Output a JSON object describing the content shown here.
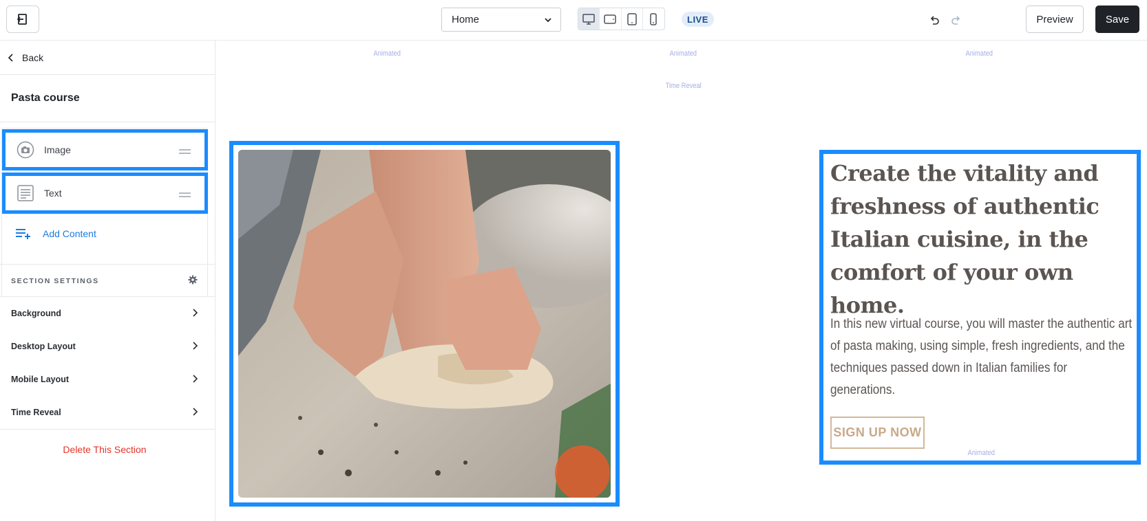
{
  "topbar": {
    "page_select": {
      "value": "Home"
    },
    "live_badge": "LIVE",
    "preview_label": "Preview",
    "save_label": "Save"
  },
  "sidebar": {
    "back_label": "Back",
    "section_title": "Pasta course",
    "content_items": [
      {
        "label": "Image",
        "icon": "camera-icon"
      },
      {
        "label": "Text",
        "icon": "text-block-icon"
      }
    ],
    "add_content_label": "Add Content",
    "section_settings_heading": "SECTION SETTINGS",
    "settings": [
      {
        "label": "Background"
      },
      {
        "label": "Desktop Layout"
      },
      {
        "label": "Mobile Layout"
      },
      {
        "label": "Time Reveal"
      }
    ],
    "delete_label": "Delete This Section"
  },
  "canvas": {
    "animated_label": "Animated",
    "time_reveal_label": "Time Reveal",
    "headline": "Create the vitality and freshness of authentic Italian cuisine, in the comfort of your own home.",
    "body": "In this new virtual course, you will master the authentic art of pasta making, using simple, fresh ingredients, and the techniques passed down in Italian families for generations.",
    "cta_label": "SIGN UP NOW"
  },
  "colors": {
    "selection_blue": "#1a8cff",
    "accent_link": "#1a7be0",
    "danger": "#e5342a",
    "heading_text": "#5b5552",
    "cta_border": "#d2b79a"
  }
}
